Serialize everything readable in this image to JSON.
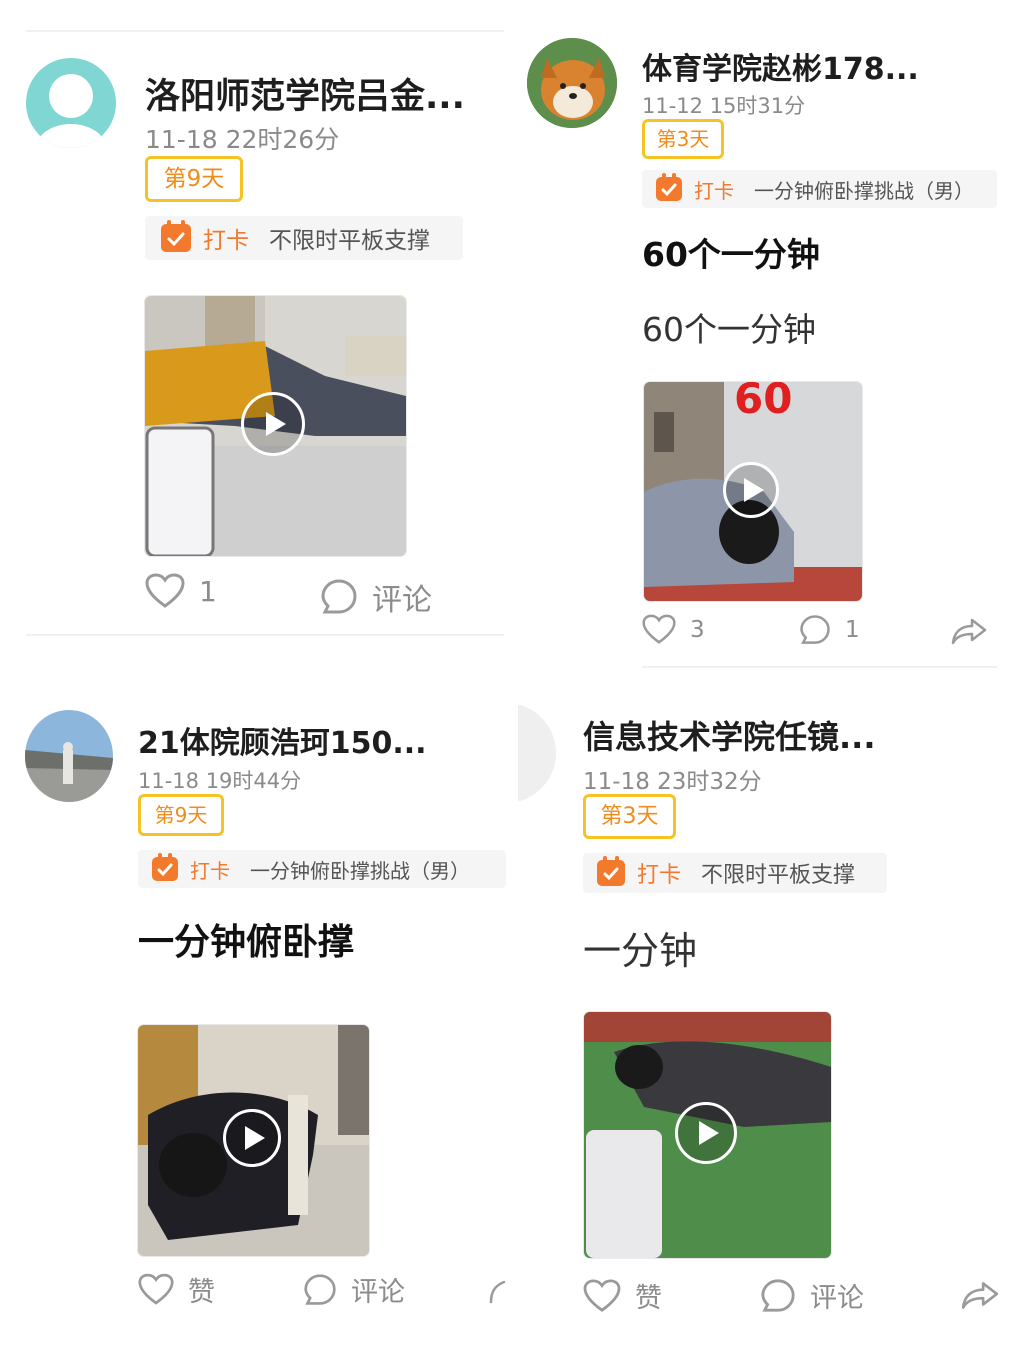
{
  "posts": [
    {
      "name": "洛阳师范学院吕金...",
      "time": "11-18 22时26分",
      "day": "第9天",
      "checkin_label": "打卡",
      "checkin_topic": "不限时平板支撑",
      "like": "1",
      "comment": "评论"
    },
    {
      "name": "体育学院赵彬178...",
      "time": "11-12 15时31分",
      "day": "第3天",
      "checkin_label": "打卡",
      "checkin_topic": "一分钟俯卧撑挑战（男）",
      "title": "60个一分钟",
      "body": "60个一分钟",
      "video_overlay": "60",
      "like": "3",
      "comment": "1"
    },
    {
      "name": "21体院顾浩珂150...",
      "time": "11-18 19时44分",
      "day": "第9天",
      "checkin_label": "打卡",
      "checkin_topic": "一分钟俯卧撑挑战（男）",
      "title": "一分钟俯卧撑",
      "like": "赞",
      "comment": "评论"
    },
    {
      "name": "信息技术学院任镜...",
      "time": "11-18 23时32分",
      "day": "第3天",
      "checkin_label": "打卡",
      "checkin_topic": "不限时平板支撑",
      "body": "一分钟",
      "like": "赞",
      "comment": "评论"
    }
  ],
  "colors": {
    "accent": "#f3792c",
    "badge_border": "#f6c326",
    "muted": "#8a8a8a"
  },
  "icons": [
    "calendar-check-icon",
    "heart-icon",
    "comment-icon",
    "share-icon",
    "play-icon"
  ]
}
